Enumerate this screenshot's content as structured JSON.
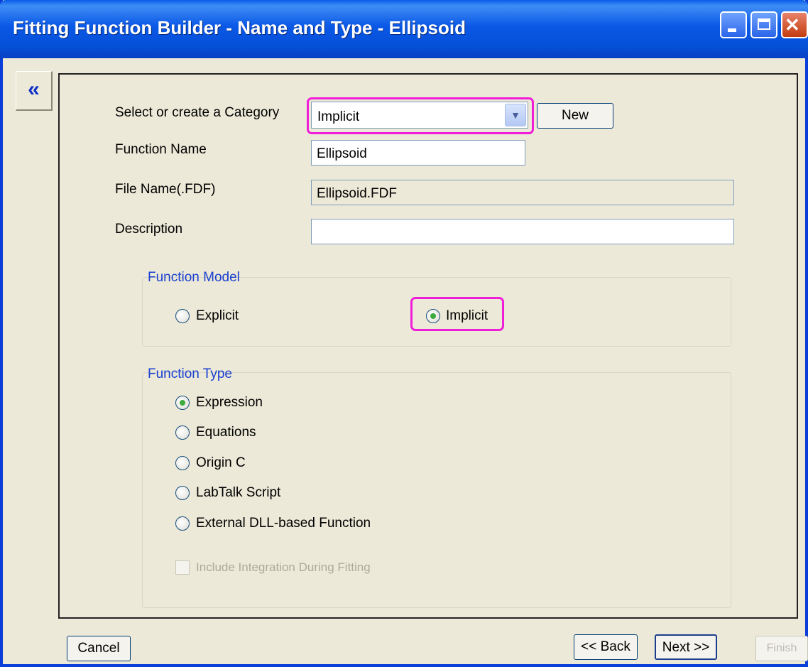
{
  "window": {
    "title": "Fitting Function Builder - Name and Type - Ellipsoid",
    "controls": [
      "minimize-icon",
      "maximize-icon",
      "close-icon"
    ]
  },
  "collapse_button": {
    "glyph": "«"
  },
  "form": {
    "category_label": "Select or create a Category",
    "category_value": "Implicit",
    "new_button": "New",
    "function_name_label": "Function Name",
    "function_name_value": "Ellipsoid",
    "file_name_label": "File Name(.FDF)",
    "file_name_value": "Ellipsoid.FDF",
    "description_label": "Description",
    "description_value": ""
  },
  "function_model": {
    "title": "Function Model",
    "options": [
      {
        "label": "Explicit",
        "selected": false
      },
      {
        "label": "Implicit",
        "selected": true
      }
    ]
  },
  "function_type": {
    "title": "Function Type",
    "options": [
      {
        "label": "Expression",
        "selected": true
      },
      {
        "label": "Equations",
        "selected": false
      },
      {
        "label": "Origin C",
        "selected": false
      },
      {
        "label": "LabTalk Script",
        "selected": false
      },
      {
        "label": "External DLL-based Function",
        "selected": false
      }
    ],
    "checkbox_label": "Include Integration During Fitting",
    "checkbox_enabled": false
  },
  "buttons": {
    "cancel": "Cancel",
    "back": "<< Back",
    "next": "Next >>",
    "finish": "Finish"
  },
  "colors": {
    "highlight": "#f01ed8",
    "titlebar": "#0a58e6",
    "group_title": "#1a40d0"
  }
}
